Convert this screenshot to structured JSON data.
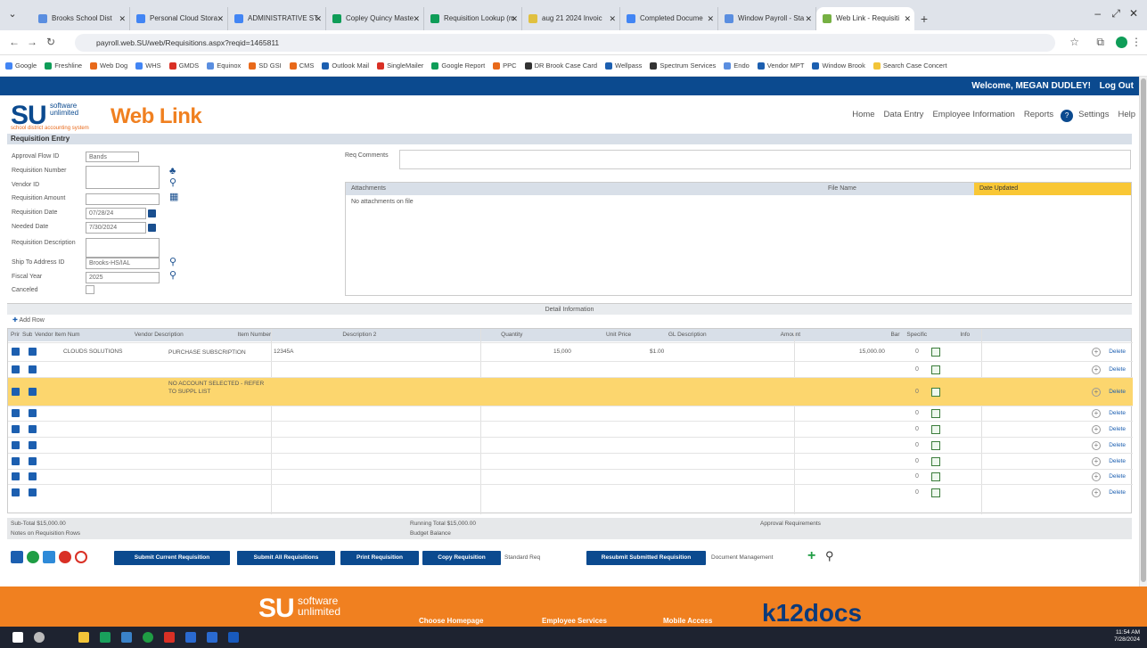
{
  "browser": {
    "tabs": [
      {
        "label": "Brooks School Dist",
        "color": "#5a8ee0",
        "active": false
      },
      {
        "label": "Personal Cloud Stora",
        "color": "#4285f4",
        "active": false
      },
      {
        "label": "ADMINISTRATIVE ST",
        "color": "#4285f4",
        "active": false
      },
      {
        "label": "Copley Quincy Maste",
        "color": "#0f9d58",
        "active": false
      },
      {
        "label": "Requisition Lookup (m",
        "color": "#0f9d58",
        "active": false
      },
      {
        "label": "aug 21 2024 Invoic",
        "color": "#e0c040",
        "active": false
      },
      {
        "label": "Completed Docume",
        "color": "#4285f4",
        "active": false
      },
      {
        "label": "Window Payroll - Sta",
        "color": "#5a8ee0",
        "active": false
      },
      {
        "label": "Web Link - Requisiti",
        "color": "#76b043",
        "active": true
      }
    ],
    "url": "payroll.web.SU/web/Requisitions.aspx?reqid=1465811",
    "bookmarks": [
      "Google",
      "Freshline",
      "Web Dog",
      "WHS",
      "GMDS",
      "Equinox",
      "SD GSI",
      "CMS",
      "Outlook Mail",
      "SingleMailer",
      "Google Report",
      "PPC",
      "DR Brook Case Card",
      "Wellpass",
      "Spectrum Services",
      "Endo",
      "Vendor MPT",
      "Window Brook",
      "Search Case Concert"
    ]
  },
  "app": {
    "welcome": "Welcome, MEGAN DUDLEY!",
    "logout": "Log Out",
    "brand_su": "SU",
    "brand_sub1": "software",
    "brand_sub2": "unlimited",
    "tagline": "school district accounting system",
    "product": "Web Link",
    "nav": [
      "Home",
      "Data Entry",
      "Employee Information",
      "Reports",
      "Settings",
      "Help"
    ],
    "help_badge": "?"
  },
  "form": {
    "title": "Requisition Entry",
    "fields": [
      {
        "label": "Approval Flow ID",
        "value": "Bands"
      },
      {
        "label": "Requisition Number",
        "value": ""
      },
      {
        "label": "Vendor ID",
        "value": ""
      },
      {
        "label": "Requisition Amount",
        "value": ""
      },
      {
        "label": "Requisition Date",
        "value": "07/28/24"
      },
      {
        "label": "Needed Date",
        "value": "7/30/2024"
      },
      {
        "label": "Requisition Description",
        "value": ""
      },
      {
        "label": "Ship To Address ID",
        "value": "Brooks-HS/IAL"
      },
      {
        "label": "Fiscal Year",
        "value": "2025"
      },
      {
        "label": "Canceled",
        "value": ""
      }
    ],
    "remarks_label": "Req Comments",
    "attachments": {
      "headers": [
        "Attachments",
        "File Name",
        "Date Updated"
      ],
      "empty": "No attachments on file"
    }
  },
  "detail": {
    "bar": "Detail Information",
    "add_row": "Add Row",
    "headers": [
      "Print",
      "Sub",
      "Vendor Item Num",
      "Vendor Description",
      "Item Number",
      "Description 2",
      "Quantity",
      "Unit Price",
      "GL Description",
      "Amount",
      "Bar",
      "Specific",
      "Info"
    ],
    "rows": [
      {
        "item": "CLOUDS SOLUTIONS",
        "desc": "PURCHASE SUBSCRIPTION",
        "itemnum": "12345A",
        "qty": "15,000",
        "price": "$1.00",
        "amount": "15,000.00"
      },
      {
        "item": "",
        "desc": "",
        "itemnum": "",
        "qty": "",
        "price": "",
        "amount": ""
      },
      {
        "item": "",
        "desc": "NO ACCOUNT SELECTED - REFER TO SUPPL LIST",
        "itemnum": "",
        "qty": "",
        "price": "",
        "amount": ""
      },
      {
        "item": "",
        "desc": "",
        "itemnum": "",
        "qty": "",
        "price": "",
        "amount": ""
      },
      {
        "item": "",
        "desc": "",
        "itemnum": "",
        "qty": "",
        "price": "",
        "amount": ""
      },
      {
        "item": "",
        "desc": "",
        "itemnum": "",
        "qty": "",
        "price": "",
        "amount": ""
      },
      {
        "item": "",
        "desc": "",
        "itemnum": "",
        "qty": "",
        "price": "",
        "amount": ""
      },
      {
        "item": "",
        "desc": "",
        "itemnum": "",
        "qty": "",
        "price": "",
        "amount": ""
      },
      {
        "item": "",
        "desc": "",
        "itemnum": "",
        "qty": "",
        "price": "",
        "amount": ""
      }
    ],
    "delete_label": "Delete",
    "sm_label": "0"
  },
  "totals": {
    "subtotal": "Sub-Total $15,000.00",
    "notes": "Notes on Requisition Rows",
    "running": "Running Total $15,000.00",
    "budget": "Budget Balance",
    "approved": "Approval Requirements"
  },
  "actions": {
    "buttons": [
      "Submit Current Requisition",
      "Submit All Requisitions",
      "Print Requisition",
      "Copy Requisition",
      "Resubmit Submitted Requisition"
    ],
    "checkbox_label": "Standard Req",
    "document_label": "Document Management"
  },
  "footer": {
    "links": [
      "Choose Homepage",
      "Employee Services",
      "Mobile Access"
    ],
    "k12": "k12docs"
  },
  "clock": {
    "time": "11:54 AM",
    "date": "7/28/2024"
  }
}
